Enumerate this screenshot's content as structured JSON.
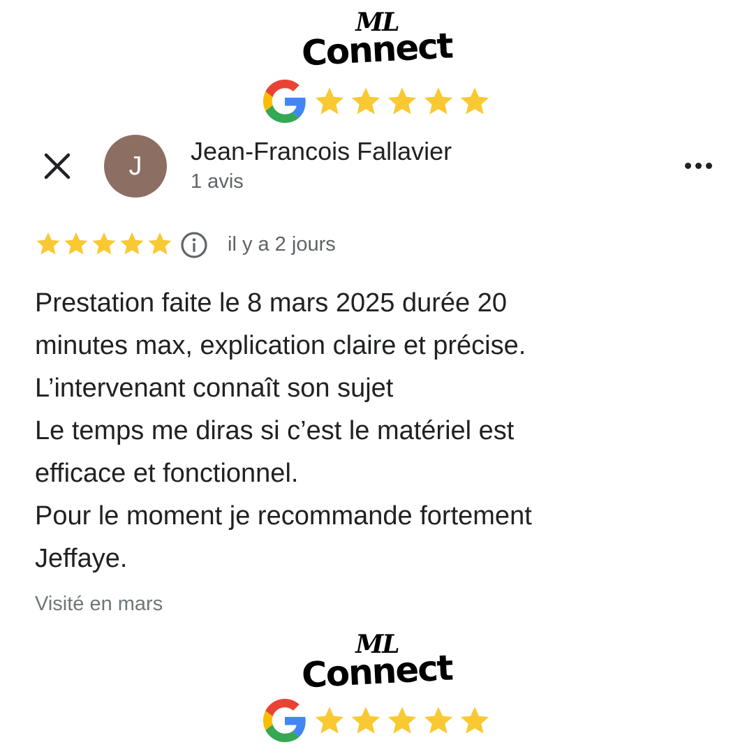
{
  "brand": {
    "logo_line1": "ML",
    "logo_line2": "Connect",
    "star_color": "#f9c933",
    "rating_stars": 5
  },
  "review": {
    "close_icon": "close-icon",
    "author": {
      "initial": "J",
      "name": "Jean-Francois Fallavier",
      "meta": "1 avis",
      "avatar_color": "#8d6e63"
    },
    "more_icon": "more-horizontal-icon",
    "rating": 5,
    "date": "il y a 2 jours",
    "text_lines": [
      "Prestation faite le 8 mars 2025 durée 20",
      "minutes max, explication claire et précise.",
      "L’intervenant connaît son sujet",
      "Le temps me diras si c’est le matériel est",
      "efficace et fonctionnel.",
      "Pour le moment je recommande fortement",
      "Jeffaye."
    ],
    "visit": "Visité en mars"
  }
}
